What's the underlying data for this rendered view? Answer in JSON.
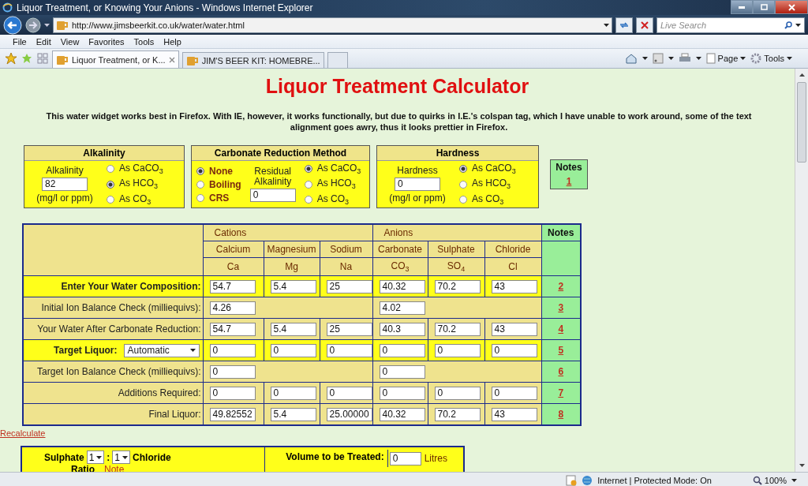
{
  "browser": {
    "title": "Liquor Treatment, or Knowing Your Anions - Windows Internet Explorer",
    "address": "http://www.jimsbeerkit.co.uk/water/water.html",
    "search": {
      "placeholder": "Live Search"
    },
    "menu": [
      "File",
      "Edit",
      "View",
      "Favorites",
      "Tools",
      "Help"
    ],
    "tabs": [
      {
        "label": "Liquor Treatment, or K...",
        "selected": true
      },
      {
        "label": "JIM'S BEER KIT: HOMEBRE...",
        "selected": false
      }
    ],
    "commands": [
      "Page",
      "Tools"
    ],
    "status": "Internet | Protected Mode: On",
    "zoom": "100%"
  },
  "page": {
    "heading": "Liquor Treatment Calculator",
    "intro": "This water widget works best in Firefox. With IE, however, it works functionally, but due to quirks in I.E.'s colspan tag, which I have unable to work around, some of the text alignment goes awry, thus it looks prettier in Firefox.",
    "alkalinity": {
      "title": "Alkalinity",
      "label": "Alkalinity",
      "value": "82",
      "unit": "(mg/l or ppm)",
      "options": [
        {
          "label": "As CaCO$_{3}$",
          "selected": false
        },
        {
          "label": "As HCO$_{3}$",
          "selected": true
        },
        {
          "label": "As CO$_{3}$",
          "selected": false
        }
      ]
    },
    "carbonate": {
      "title": "Carbonate Reduction Method",
      "methods": [
        {
          "label": "None",
          "selected": true
        },
        {
          "label": "Boiling",
          "selected": false
        },
        {
          "label": "CRS",
          "selected": false
        }
      ],
      "label": "Residual Alkalinity",
      "value": "0",
      "options": [
        {
          "label": "As CaCO$_{3}$",
          "selected": true
        },
        {
          "label": "As HCO$_{3}$",
          "selected": false
        },
        {
          "label": "As CO$_{3}$",
          "selected": false
        }
      ]
    },
    "hardness": {
      "title": "Hardness",
      "label": "Hardness",
      "value": "0",
      "unit": "(mg/l or ppm)",
      "options": [
        {
          "label": "As CaCO$_{3}$",
          "selected": true
        },
        {
          "label": "As HCO$_{3}$",
          "selected": false
        },
        {
          "label": "As CO$_{3}$",
          "selected": false
        }
      ]
    },
    "notes_box": {
      "title": "Notes",
      "link": "1"
    },
    "table": {
      "groups": [
        "Cations",
        "Anions"
      ],
      "notes_title": "Notes",
      "columns": [
        {
          "name": "Calcium",
          "symbol": "Ca"
        },
        {
          "name": "Magnesium",
          "symbol": "Mg"
        },
        {
          "name": "Sodium",
          "symbol": "Na"
        },
        {
          "name": "Carbonate",
          "symbol": "CO$_{3}$"
        },
        {
          "name": "Sulphate",
          "symbol": "SO$_{4}$"
        },
        {
          "name": "Chloride",
          "symbol": "Cl"
        }
      ],
      "rows": [
        {
          "kind": "values",
          "label": "Enter Your Water Composition:",
          "highlighted": true,
          "values": [
            "54.7",
            "5.4",
            "25",
            "40.32",
            "70.2",
            "43"
          ],
          "note": "2"
        },
        {
          "kind": "balance",
          "label": "Initial Ion Balance Check (milliequivs):",
          "highlighted": false,
          "values": [
            "4.26",
            "4.02"
          ],
          "note": "3"
        },
        {
          "kind": "values",
          "label": "Your Water After Carbonate Reduction:",
          "highlighted": false,
          "values": [
            "54.7",
            "5.4",
            "25",
            "40.3",
            "70.2",
            "43"
          ],
          "note": "4"
        },
        {
          "kind": "select",
          "label": "Target Liquor:",
          "select": "Automatic",
          "highlighted": true,
          "values": [
            "0",
            "0",
            "0",
            "0",
            "0",
            "0"
          ],
          "note": "5"
        },
        {
          "kind": "balance",
          "label": "Target Ion Balance Check (milliequivs):",
          "highlighted": false,
          "values": [
            "0",
            "0"
          ],
          "note": "6"
        },
        {
          "kind": "values",
          "label": "Additions Required:",
          "highlighted": false,
          "values": [
            "0",
            "0",
            "0",
            "0",
            "0",
            "0"
          ],
          "note": "7"
        },
        {
          "kind": "values",
          "label": "Final Liquor:",
          "highlighted": false,
          "values": [
            "49.82552",
            "5.4",
            "25.00000",
            "40.32",
            "70.2",
            "43"
          ],
          "note": "8"
        }
      ]
    },
    "recalculate": "Recalculate",
    "ratio": {
      "left": "Sulphate",
      "left_value": "1",
      "separator": ":",
      "right_value": "1",
      "right": "Chloride",
      "label": "Ratio",
      "note": "Note"
    },
    "volume": {
      "label": "Volume to be Treated:",
      "value": "0",
      "unit": "Litres"
    }
  }
}
